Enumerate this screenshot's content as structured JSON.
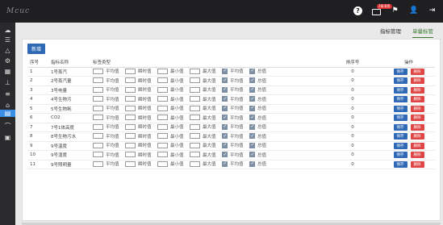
{
  "app": {
    "logo_text": "Mcuc"
  },
  "topbar": {
    "mail_badge": "2条消息",
    "icons": [
      "help-icon",
      "mail-icon",
      "flag-icon",
      "user-icon",
      "logout-icon"
    ]
  },
  "sidebar": {
    "icons": [
      "cloud-icon",
      "list-icon",
      "alert-icon",
      "settings-icon",
      "chart-icon",
      "device-icon",
      "layers-icon",
      "home-icon",
      "bookmark-icon",
      "monitor-icon",
      "map-icon"
    ],
    "active_index": 8
  },
  "tabs": [
    {
      "label": "指标管理",
      "active": false
    },
    {
      "label": "单量标管",
      "active": true
    }
  ],
  "toolbar": {
    "add_label": "新增"
  },
  "table": {
    "headers": {
      "seq": "序号",
      "name": "指标名称",
      "indicator": "标签类型",
      "sort": "排序号",
      "ops": "操作"
    },
    "option_labels": [
      "平均值",
      "瞬时值",
      "最小值",
      "最大值",
      "平均值",
      "总值"
    ],
    "rows": [
      {
        "seq": "1",
        "name": "1号蒸汽",
        "options": [
          false,
          false,
          false,
          false,
          true,
          true
        ],
        "sort": "0"
      },
      {
        "seq": "2",
        "name": "2号蒸汽量",
        "options": [
          false,
          false,
          false,
          false,
          true,
          true
        ],
        "sort": "0"
      },
      {
        "seq": "3",
        "name": "3号电量",
        "options": [
          false,
          false,
          false,
          false,
          true,
          true
        ],
        "sort": "0"
      },
      {
        "seq": "4",
        "name": "4号生物污",
        "options": [
          false,
          false,
          false,
          false,
          true,
          true
        ],
        "sort": "0"
      },
      {
        "seq": "5",
        "name": "5号生物耗",
        "options": [
          false,
          false,
          false,
          false,
          true,
          true
        ],
        "sort": "0"
      },
      {
        "seq": "6",
        "name": "CO2",
        "options": [
          false,
          false,
          false,
          false,
          true,
          true
        ],
        "sort": "0"
      },
      {
        "seq": "7",
        "name": "7号1体高度",
        "options": [
          false,
          false,
          false,
          false,
          true,
          true
        ],
        "sort": "0"
      },
      {
        "seq": "8",
        "name": "8号生物污水",
        "options": [
          false,
          false,
          false,
          false,
          true,
          true
        ],
        "sort": "0"
      },
      {
        "seq": "9",
        "name": "9号温度",
        "options": [
          false,
          false,
          false,
          false,
          true,
          true
        ],
        "sort": "0"
      },
      {
        "seq": "10",
        "name": "9号湿度",
        "options": [
          false,
          false,
          false,
          false,
          true,
          true
        ],
        "sort": "0"
      },
      {
        "seq": "11",
        "name": "9号照明量",
        "options": [
          false,
          false,
          false,
          false,
          true,
          true
        ],
        "sort": "0"
      }
    ],
    "save_label": "保存",
    "delete_label": "删除"
  }
}
